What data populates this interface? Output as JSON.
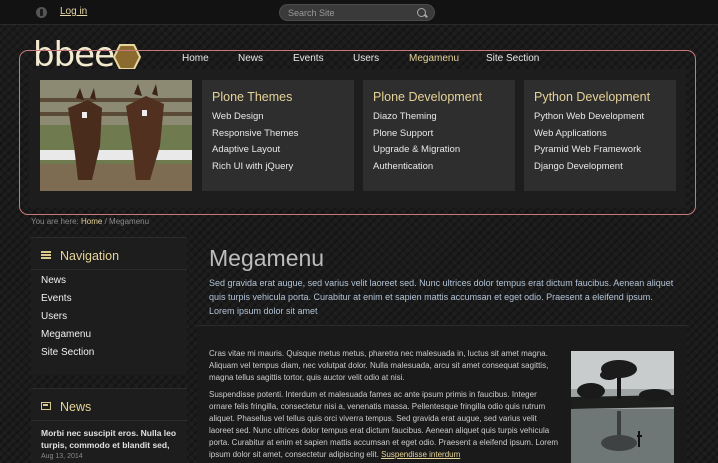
{
  "topbar": {
    "login": "Log in",
    "search_placeholder": "Search Site"
  },
  "logo": {
    "text": "bbee"
  },
  "nav": [
    "Home",
    "News",
    "Events",
    "Users",
    "Megamenu",
    "Site Section"
  ],
  "megamenu": {
    "columns": [
      {
        "title": "Plone Themes",
        "items": [
          "Web Design",
          "Responsive Themes",
          "Adaptive Layout",
          "Rich UI with jQuery"
        ]
      },
      {
        "title": "Plone Development",
        "items": [
          "Diazo Theming",
          "Plone Support",
          "Upgrade & Migration",
          "Authentication"
        ]
      },
      {
        "title": "Python Development",
        "items": [
          "Python Web Development",
          "Web Applications",
          "Pyramid Web Framework",
          "Django Development"
        ]
      }
    ]
  },
  "breadcrumb": {
    "prefix": "You are here:",
    "home": "Home",
    "separator": "/",
    "current": "Megamenu"
  },
  "sidebar": {
    "navigation": {
      "title": "Navigation",
      "items": [
        "News",
        "Events",
        "Users",
        "Megamenu",
        "Site Section"
      ]
    },
    "news": {
      "title": "News",
      "headline": "Morbi nec suscipit eros. Nulla leo turpis, commodo et blandit sed,",
      "date": "Aug 13, 2014"
    }
  },
  "content": {
    "title": "Megamenu",
    "lead": "Sed gravida erat augue, sed varius velit laoreet sed. Nunc ultrices dolor tempus erat dictum faucibus. Aenean aliquet quis turpis vehicula porta. Curabitur at enim et sapien mattis accumsan et eget odio. Praesent a eleifend ipsum. Lorem ipsum dolor sit amet",
    "paragraph1": "Cras vitae mi mauris. Quisque metus metus, pharetra nec malesuada in, luctus sit amet magna. Aliquam vel tempus diam, nec volutpat dolor. Nulla malesuada, arcu sit amet consequat sagittis, magna tellus sagittis tortor, quis auctor velit odio at nisi.",
    "paragraph2": "Suspendisse potenti. Interdum et malesuada fames ac ante ipsum primis in faucibus. Integer ornare felis fringilla, consectetur nisi a, venenatis massa. Pellentesque fringilla odio quis rutrum aliquet. Phasellus vel tellus quis orci viverra tempus. Sed gravida erat augue, sed varius velit laoreet sed. Nunc ultrices dolor tempus erat dictum faucibus. Aenean aliquet quis turpis vehicula porta. Curabitur at enim et sapien mattis accumsan et eget odio. Praesent a eleifend ipsum. Lorem ipsum dolor sit amet, consectetur adipiscing elit.",
    "link": "Suspendisse interdum"
  }
}
